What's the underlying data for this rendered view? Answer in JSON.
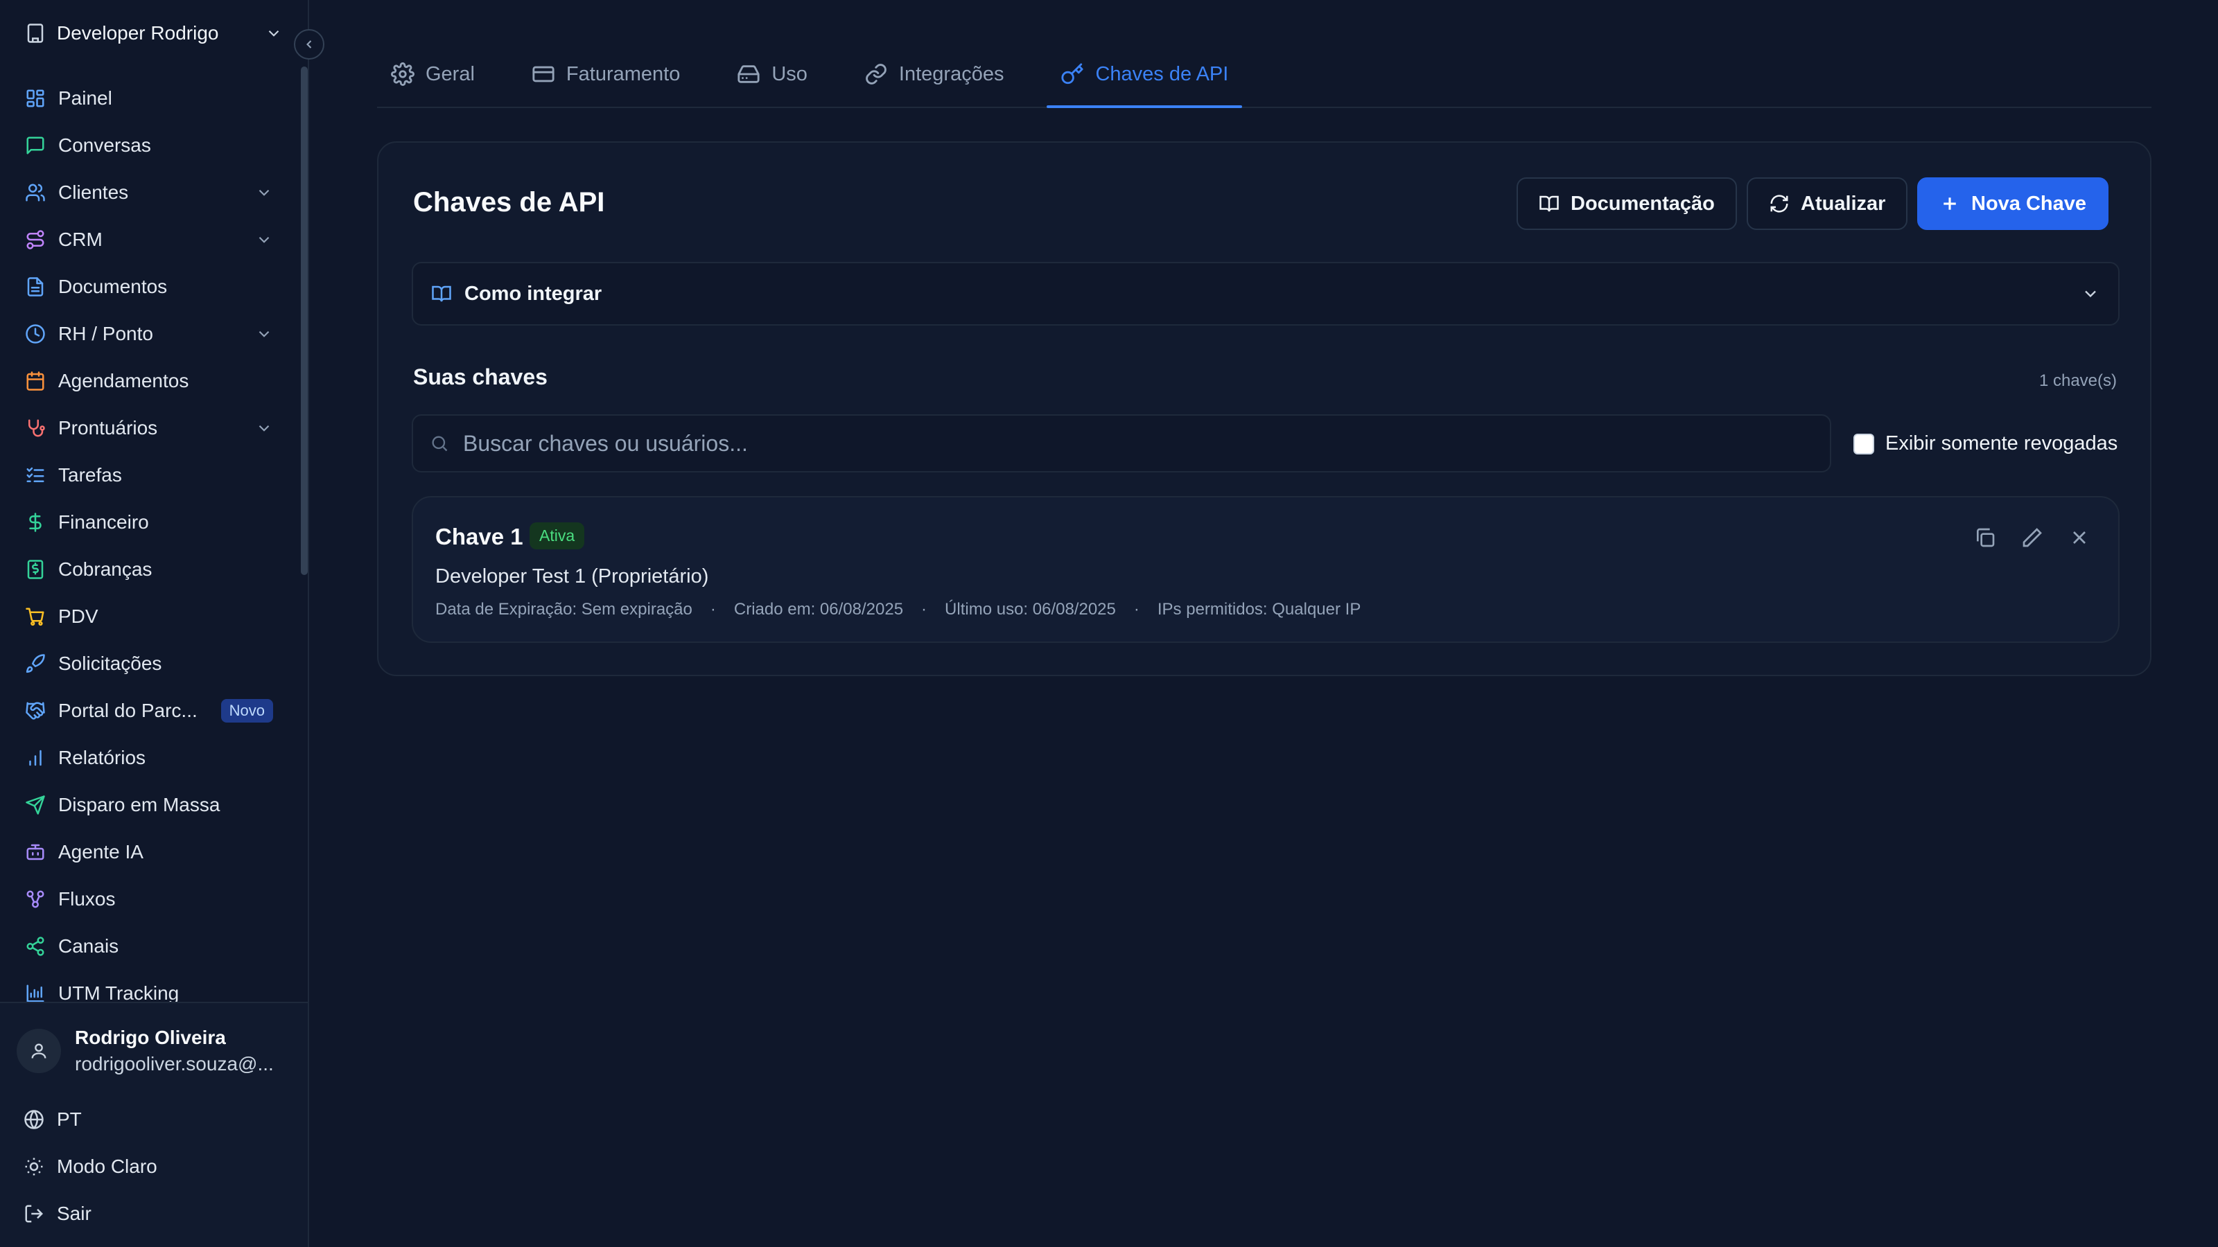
{
  "sidebar": {
    "org_name": "Developer Rodrigo",
    "items": [
      {
        "label": "Painel",
        "icon": "dashboard-icon",
        "color": "#60a5fa",
        "expandable": false
      },
      {
        "label": "Conversas",
        "icon": "chat-icon",
        "color": "#34d399",
        "expandable": false
      },
      {
        "label": "Clientes",
        "icon": "users-icon",
        "color": "#60a5fa",
        "expandable": true
      },
      {
        "label": "CRM",
        "icon": "route-icon",
        "color": "#c084fc",
        "expandable": true
      },
      {
        "label": "Documentos",
        "icon": "document-icon",
        "color": "#60a5fa",
        "expandable": false
      },
      {
        "label": "RH / Ponto",
        "icon": "clock-icon",
        "color": "#60a5fa",
        "expandable": true
      },
      {
        "label": "Agendamentos",
        "icon": "calendar-icon",
        "color": "#fb923c",
        "expandable": false
      },
      {
        "label": "Prontuários",
        "icon": "stethoscope-icon",
        "color": "#f87171",
        "expandable": true
      },
      {
        "label": "Tarefas",
        "icon": "tasks-icon",
        "color": "#60a5fa",
        "expandable": false
      },
      {
        "label": "Financeiro",
        "icon": "dollar-icon",
        "color": "#34d399",
        "expandable": false
      },
      {
        "label": "Cobranças",
        "icon": "receipt-icon",
        "color": "#34d399",
        "expandable": false
      },
      {
        "label": "PDV",
        "icon": "cart-icon",
        "color": "#fbbf24",
        "expandable": false
      },
      {
        "label": "Solicitações",
        "icon": "rocket-icon",
        "color": "#60a5fa",
        "expandable": false
      },
      {
        "label": "Portal do Parc...",
        "icon": "handshake-icon",
        "color": "#60a5fa",
        "expandable": false,
        "badge": "Novo"
      },
      {
        "label": "Relatórios",
        "icon": "bar-chart-icon",
        "color": "#60a5fa",
        "expandable": false
      },
      {
        "label": "Disparo em Massa",
        "icon": "send-icon",
        "color": "#34d399",
        "expandable": false
      },
      {
        "label": "Agente IA",
        "icon": "bot-icon",
        "color": "#a78bfa",
        "expandable": false
      },
      {
        "label": "Fluxos",
        "icon": "workflow-icon",
        "color": "#a78bfa",
        "expandable": false
      },
      {
        "label": "Canais",
        "icon": "share-icon",
        "color": "#34d399",
        "expandable": false
      },
      {
        "label": "UTM Tracking",
        "icon": "chart-icon",
        "color": "#60a5fa",
        "expandable": false
      }
    ],
    "user": {
      "name": "Rodrigo Oliveira",
      "email": "rodrigooliver.souza@..."
    },
    "language": "PT",
    "theme_toggle": "Modo Claro",
    "logout": "Sair"
  },
  "tabs": [
    {
      "label": "Geral",
      "icon": "gear-icon",
      "active": false
    },
    {
      "label": "Faturamento",
      "icon": "credit-card-icon",
      "active": false
    },
    {
      "label": "Uso",
      "icon": "hard-drive-icon",
      "active": false
    },
    {
      "label": "Integrações",
      "icon": "link-icon",
      "active": false
    },
    {
      "label": "Chaves de API",
      "icon": "key-icon",
      "active": true
    }
  ],
  "main": {
    "title": "Chaves de API",
    "buttons": {
      "docs": "Documentação",
      "refresh": "Atualizar",
      "new_key": "Nova Chave"
    },
    "accordion": "Como integrar",
    "section_title": "Suas chaves",
    "count": "1 chave(s)",
    "search_placeholder": "Buscar chaves ou usuários...",
    "revoked_label": "Exibir somente revogadas",
    "keys": [
      {
        "name": "Chave 1",
        "status": "Ativa",
        "owner": "Developer Test 1 (Proprietário)",
        "expiration": "Data de Expiração: Sem expiração",
        "created": "Criado em: 06/08/2025",
        "last_used": "Último uso: 06/08/2025",
        "ips": "IPs permitidos: Qualquer IP"
      }
    ]
  },
  "colors": {
    "accent": "#3b82f6",
    "primary_button": "#2563eb",
    "status_active": "#4ade80"
  }
}
